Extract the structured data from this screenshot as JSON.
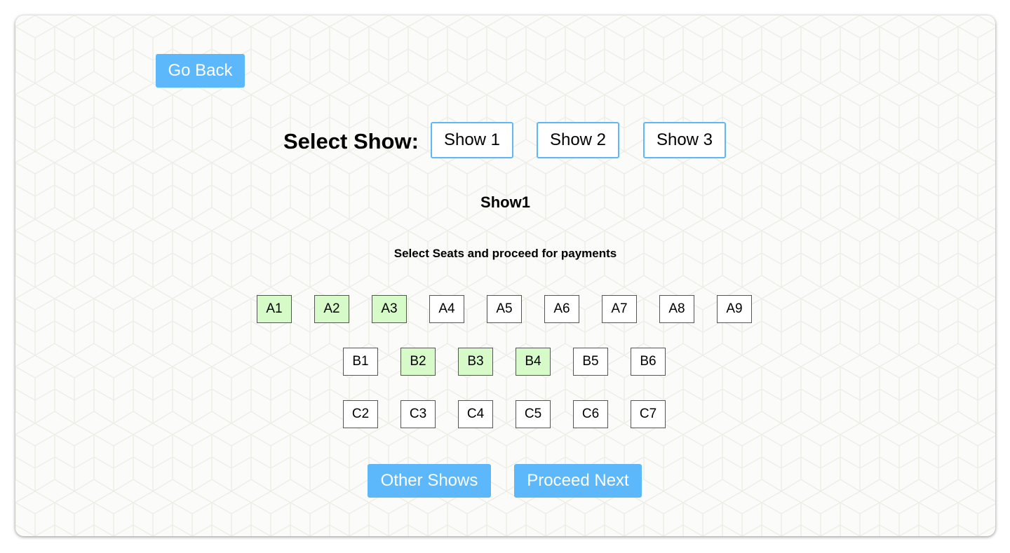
{
  "nav": {
    "go_back_label": "Go Back"
  },
  "show_selector": {
    "label": "Select Show:",
    "shows": [
      "Show 1",
      "Show 2",
      "Show 3"
    ]
  },
  "current_show": {
    "title": "Show1"
  },
  "instructions": "Select Seats and proceed for payments",
  "seat_rows": [
    [
      {
        "label": "A1",
        "selected": true
      },
      {
        "label": "A2",
        "selected": true
      },
      {
        "label": "A3",
        "selected": true
      },
      {
        "label": "A4",
        "selected": false
      },
      {
        "label": "A5",
        "selected": false
      },
      {
        "label": "A6",
        "selected": false
      },
      {
        "label": "A7",
        "selected": false
      },
      {
        "label": "A8",
        "selected": false
      },
      {
        "label": "A9",
        "selected": false
      }
    ],
    [
      {
        "label": "B1",
        "selected": false
      },
      {
        "label": "B2",
        "selected": true
      },
      {
        "label": "B3",
        "selected": true
      },
      {
        "label": "B4",
        "selected": true
      },
      {
        "label": "B5",
        "selected": false
      },
      {
        "label": "B6",
        "selected": false
      }
    ],
    [
      {
        "label": "C2",
        "selected": false
      },
      {
        "label": "C3",
        "selected": false
      },
      {
        "label": "C4",
        "selected": false
      },
      {
        "label": "C5",
        "selected": false
      },
      {
        "label": "C6",
        "selected": false
      },
      {
        "label": "C7",
        "selected": false
      }
    ]
  ],
  "actions": {
    "other_shows_label": "Other Shows",
    "proceed_next_label": "Proceed Next"
  },
  "colors": {
    "accent": "#5cb8fb",
    "selected_seat": "#d6fbc8",
    "background": "#fbfbf9"
  }
}
